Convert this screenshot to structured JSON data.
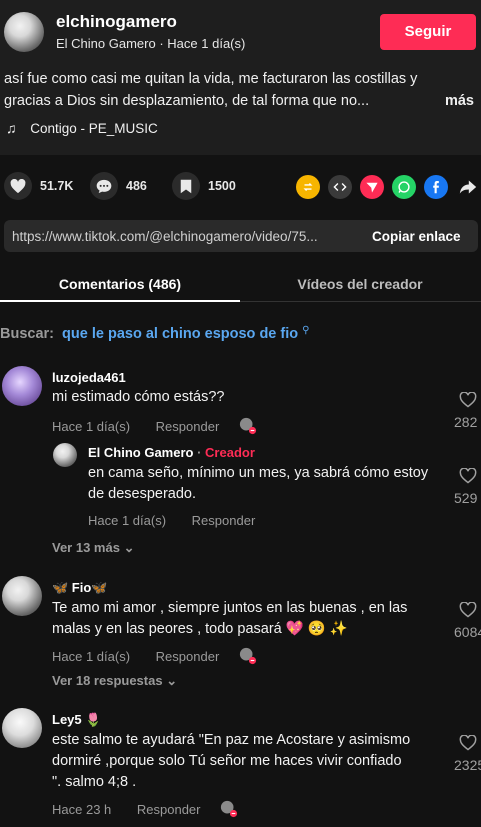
{
  "post": {
    "username": "elchinogamero",
    "display_name": "El Chino Gamero",
    "time": "Hace 1 día(s)",
    "follow_label": "Seguir",
    "description": "así fue como casi me quitan la vida, me facturaron las costillas y gracias a Dios sin desplazamiento, de tal forma que no...",
    "more_label": "más",
    "music_note_icon": "♫",
    "music": "Contigo - PE_MUSIC"
  },
  "actions": {
    "likes": "51.7K",
    "comments": "486",
    "saves": "1500",
    "share_colors": [
      "#f7b500",
      "#3a3a3a",
      "#fe2c55",
      "#25d366",
      "#1877f2"
    ]
  },
  "link": {
    "url": "https://www.tiktok.com/@elchinogamero/video/75...",
    "copy_label": "Copiar enlace"
  },
  "tabs": {
    "comments": "Comentarios (486)",
    "creator_videos": "Vídeos del creador"
  },
  "search": {
    "label": "Buscar:",
    "query": "que le paso al chino esposo de fio",
    "icon": "⚲"
  },
  "comments": [
    {
      "name": "luzojeda461",
      "text": "mi estimado cómo estás??",
      "time": "Hace 1 día(s)",
      "reply_label": "Responder",
      "likes": "282"
    },
    {
      "name": "El Chino Gamero",
      "sep": " · ",
      "badge": "Creador",
      "text": "en cama seño, mínimo un mes, ya sabrá cómo estoy de desesperado.",
      "time": "Hace 1 día(s)",
      "reply_label": "Responder",
      "likes": "529"
    },
    {
      "name": "🦋 Fio🦋",
      "text": "Te amo mi amor , siempre juntos en las buenas , en las malas y en las peores , todo pasará 💖 🥺 ✨",
      "time": "Hace 1 día(s)",
      "reply_label": "Responder",
      "likes": "6084"
    },
    {
      "name": "Ley5 🌷",
      "text": "este salmo te ayudará \"En paz me Acostare y asimismo dormiré ,porque solo Tú señor me haces vivir confiado \". salmo 4;8 .",
      "time": "Hace 23 h",
      "reply_label": "Responder",
      "likes": "2325"
    }
  ],
  "more_replies": {
    "first": "Ver 13 más",
    "second": "Ver 18 respuestas",
    "chevron": "⌄"
  }
}
